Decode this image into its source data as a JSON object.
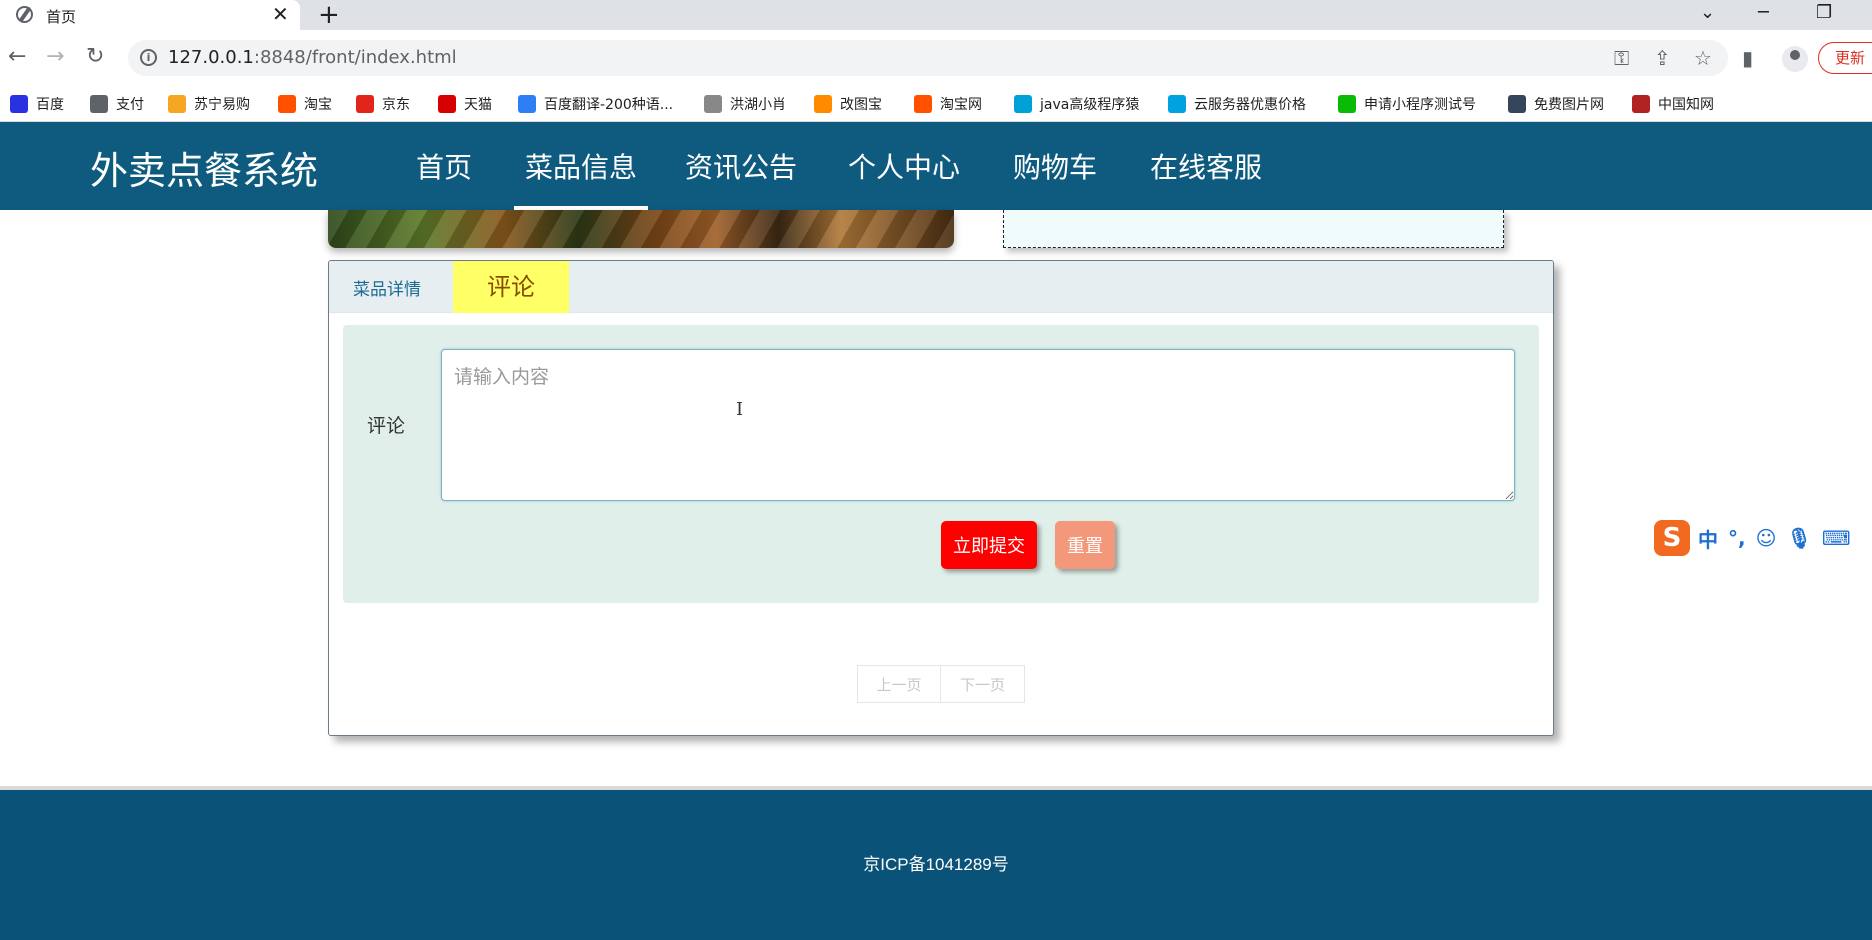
{
  "browser": {
    "tab_title": "首页",
    "tab_close": "✕",
    "new_tab": "+",
    "url_host": "127.0.0.1",
    "url_path": ":8848/front/index.html",
    "update_label": "更新",
    "bookmarks": [
      {
        "label": "百度",
        "icon": "baidu-icon",
        "color": "#2932e1"
      },
      {
        "label": "支付",
        "icon": "globe-icon",
        "color": "#5f6368"
      },
      {
        "label": "苏宁易购",
        "icon": "suning-icon",
        "color": "#f5a623"
      },
      {
        "label": "淘宝",
        "icon": "taobao-icon",
        "color": "#ff5000"
      },
      {
        "label": "京东",
        "icon": "jd-icon",
        "color": "#e1251b"
      },
      {
        "label": "天猫",
        "icon": "tmall-icon",
        "color": "#d70000"
      },
      {
        "label": "百度翻译-200种语...",
        "icon": "translate-icon",
        "color": "#2e7ff6"
      },
      {
        "label": "洪湖小肖",
        "icon": "feather-icon",
        "color": "#888888"
      },
      {
        "label": "改图宝",
        "icon": "gaitubao-icon",
        "color": "#ff8a00"
      },
      {
        "label": "淘宝网",
        "icon": "taobao-icon",
        "color": "#ff5000"
      },
      {
        "label": "java高级程序猿",
        "icon": "bilibili-icon",
        "color": "#00a1d6"
      },
      {
        "label": "云服务器优惠价格",
        "icon": "cloud-icon",
        "color": "#00a3e0"
      },
      {
        "label": "申请小程序测试号",
        "icon": "wechat-icon",
        "color": "#09bb07"
      },
      {
        "label": "免费图片网",
        "icon": "tumblr-icon",
        "color": "#35465c"
      },
      {
        "label": "中国知网",
        "icon": "cnki-icon",
        "color": "#b22222"
      }
    ]
  },
  "site": {
    "title": "外卖点餐系统",
    "nav": [
      "首页",
      "菜品信息",
      "资讯公告",
      "个人中心",
      "购物车",
      "在线客服"
    ],
    "active_nav": "菜品信息"
  },
  "detail": {
    "tabs": {
      "detail": "菜品详情",
      "comment": "评论"
    },
    "form": {
      "label": "评论",
      "placeholder": "请输入内容",
      "value": "",
      "submit": "立即提交",
      "reset": "重置"
    },
    "pager": {
      "prev": "上一页",
      "next": "下一页"
    }
  },
  "footer": {
    "icp": "京ICP备1041289号"
  },
  "ime": {
    "logo": "S",
    "mode": "中",
    "punct": "°,"
  },
  "colors": {
    "header_bg": "#0e5b7f",
    "footer_bg": "#0a5278",
    "comment_tab_bg": "#ffff66",
    "submit_bg": "#ff0000",
    "reset_bg": "#f3987a",
    "form_bg": "#e0efea"
  }
}
